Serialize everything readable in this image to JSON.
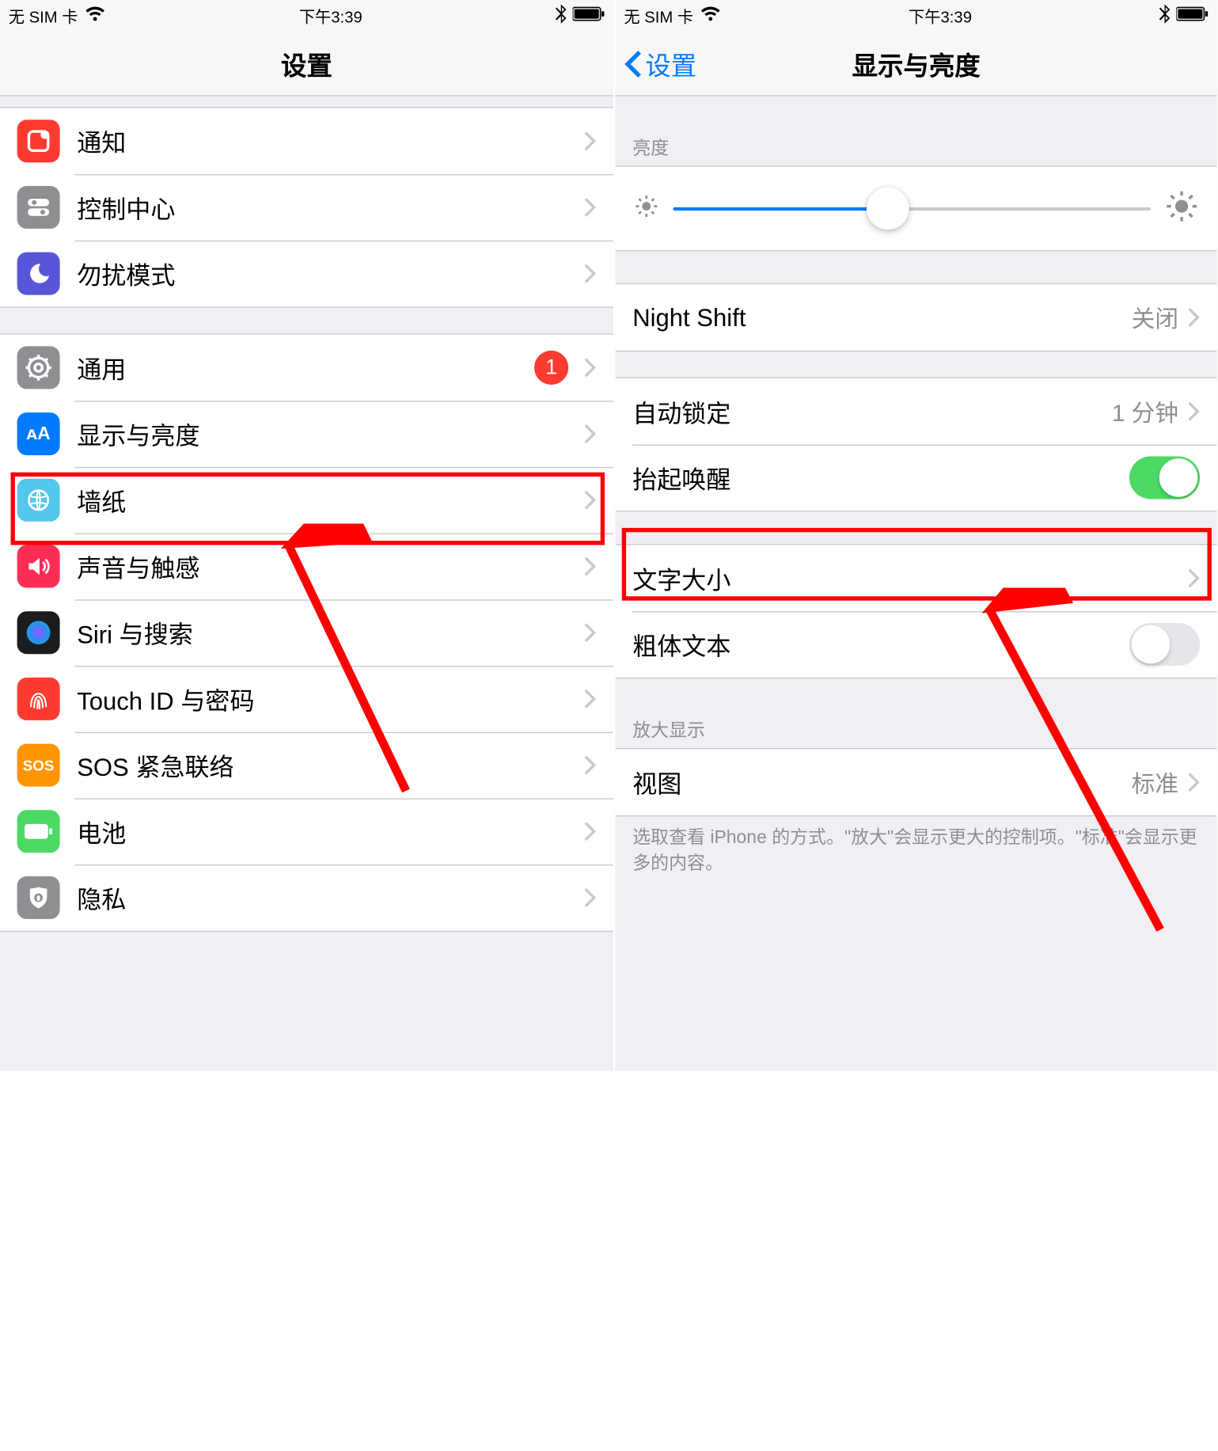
{
  "status": {
    "carrier": "无 SIM 卡",
    "time": "下午3:39"
  },
  "left": {
    "title": "设置",
    "rows": {
      "notify": "通知",
      "control": "控制中心",
      "dnd": "勿扰模式",
      "general": "通用",
      "general_badge": "1",
      "display": "显示与亮度",
      "wallpaper": "墙纸",
      "sound": "声音与触感",
      "siri": "Siri 与搜索",
      "touchid": "Touch ID 与密码",
      "sos": "SOS 紧急联络",
      "battery": "电池",
      "privacy": "隐私"
    }
  },
  "right": {
    "back": "设置",
    "title": "显示与亮度",
    "brightness_header": "亮度",
    "brightness_pct": 45,
    "night_shift": {
      "label": "Night Shift",
      "value": "关闭"
    },
    "auto_lock": {
      "label": "自动锁定",
      "value": "1 分钟"
    },
    "raise_to_wake": {
      "label": "抬起唤醒",
      "on": true
    },
    "text_size": "文字大小",
    "bold_text": {
      "label": "粗体文本",
      "on": false
    },
    "zoom_header": "放大显示",
    "view": {
      "label": "视图",
      "value": "标准"
    },
    "zoom_footer": "选取查看 iPhone 的方式。\"放大\"会显示更大的控制项。\"标准\"会显示更多的内容。"
  }
}
